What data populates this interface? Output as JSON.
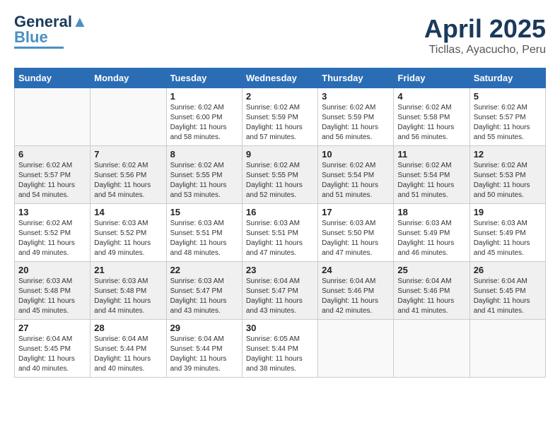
{
  "header": {
    "logo_general": "General",
    "logo_blue": "Blue",
    "month": "April 2025",
    "location": "Ticllas, Ayacucho, Peru"
  },
  "weekdays": [
    "Sunday",
    "Monday",
    "Tuesday",
    "Wednesday",
    "Thursday",
    "Friday",
    "Saturday"
  ],
  "weeks": [
    [
      {
        "day": "",
        "info": ""
      },
      {
        "day": "",
        "info": ""
      },
      {
        "day": "1",
        "info": "Sunrise: 6:02 AM\nSunset: 6:00 PM\nDaylight: 11 hours and 58 minutes."
      },
      {
        "day": "2",
        "info": "Sunrise: 6:02 AM\nSunset: 5:59 PM\nDaylight: 11 hours and 57 minutes."
      },
      {
        "day": "3",
        "info": "Sunrise: 6:02 AM\nSunset: 5:59 PM\nDaylight: 11 hours and 56 minutes."
      },
      {
        "day": "4",
        "info": "Sunrise: 6:02 AM\nSunset: 5:58 PM\nDaylight: 11 hours and 56 minutes."
      },
      {
        "day": "5",
        "info": "Sunrise: 6:02 AM\nSunset: 5:57 PM\nDaylight: 11 hours and 55 minutes."
      }
    ],
    [
      {
        "day": "6",
        "info": "Sunrise: 6:02 AM\nSunset: 5:57 PM\nDaylight: 11 hours and 54 minutes."
      },
      {
        "day": "7",
        "info": "Sunrise: 6:02 AM\nSunset: 5:56 PM\nDaylight: 11 hours and 54 minutes."
      },
      {
        "day": "8",
        "info": "Sunrise: 6:02 AM\nSunset: 5:55 PM\nDaylight: 11 hours and 53 minutes."
      },
      {
        "day": "9",
        "info": "Sunrise: 6:02 AM\nSunset: 5:55 PM\nDaylight: 11 hours and 52 minutes."
      },
      {
        "day": "10",
        "info": "Sunrise: 6:02 AM\nSunset: 5:54 PM\nDaylight: 11 hours and 51 minutes."
      },
      {
        "day": "11",
        "info": "Sunrise: 6:02 AM\nSunset: 5:54 PM\nDaylight: 11 hours and 51 minutes."
      },
      {
        "day": "12",
        "info": "Sunrise: 6:02 AM\nSunset: 5:53 PM\nDaylight: 11 hours and 50 minutes."
      }
    ],
    [
      {
        "day": "13",
        "info": "Sunrise: 6:02 AM\nSunset: 5:52 PM\nDaylight: 11 hours and 49 minutes."
      },
      {
        "day": "14",
        "info": "Sunrise: 6:03 AM\nSunset: 5:52 PM\nDaylight: 11 hours and 49 minutes."
      },
      {
        "day": "15",
        "info": "Sunrise: 6:03 AM\nSunset: 5:51 PM\nDaylight: 11 hours and 48 minutes."
      },
      {
        "day": "16",
        "info": "Sunrise: 6:03 AM\nSunset: 5:51 PM\nDaylight: 11 hours and 47 minutes."
      },
      {
        "day": "17",
        "info": "Sunrise: 6:03 AM\nSunset: 5:50 PM\nDaylight: 11 hours and 47 minutes."
      },
      {
        "day": "18",
        "info": "Sunrise: 6:03 AM\nSunset: 5:49 PM\nDaylight: 11 hours and 46 minutes."
      },
      {
        "day": "19",
        "info": "Sunrise: 6:03 AM\nSunset: 5:49 PM\nDaylight: 11 hours and 45 minutes."
      }
    ],
    [
      {
        "day": "20",
        "info": "Sunrise: 6:03 AM\nSunset: 5:48 PM\nDaylight: 11 hours and 45 minutes."
      },
      {
        "day": "21",
        "info": "Sunrise: 6:03 AM\nSunset: 5:48 PM\nDaylight: 11 hours and 44 minutes."
      },
      {
        "day": "22",
        "info": "Sunrise: 6:03 AM\nSunset: 5:47 PM\nDaylight: 11 hours and 43 minutes."
      },
      {
        "day": "23",
        "info": "Sunrise: 6:04 AM\nSunset: 5:47 PM\nDaylight: 11 hours and 43 minutes."
      },
      {
        "day": "24",
        "info": "Sunrise: 6:04 AM\nSunset: 5:46 PM\nDaylight: 11 hours and 42 minutes."
      },
      {
        "day": "25",
        "info": "Sunrise: 6:04 AM\nSunset: 5:46 PM\nDaylight: 11 hours and 41 minutes."
      },
      {
        "day": "26",
        "info": "Sunrise: 6:04 AM\nSunset: 5:45 PM\nDaylight: 11 hours and 41 minutes."
      }
    ],
    [
      {
        "day": "27",
        "info": "Sunrise: 6:04 AM\nSunset: 5:45 PM\nDaylight: 11 hours and 40 minutes."
      },
      {
        "day": "28",
        "info": "Sunrise: 6:04 AM\nSunset: 5:44 PM\nDaylight: 11 hours and 40 minutes."
      },
      {
        "day": "29",
        "info": "Sunrise: 6:04 AM\nSunset: 5:44 PM\nDaylight: 11 hours and 39 minutes."
      },
      {
        "day": "30",
        "info": "Sunrise: 6:05 AM\nSunset: 5:44 PM\nDaylight: 11 hours and 38 minutes."
      },
      {
        "day": "",
        "info": ""
      },
      {
        "day": "",
        "info": ""
      },
      {
        "day": "",
        "info": ""
      }
    ]
  ]
}
